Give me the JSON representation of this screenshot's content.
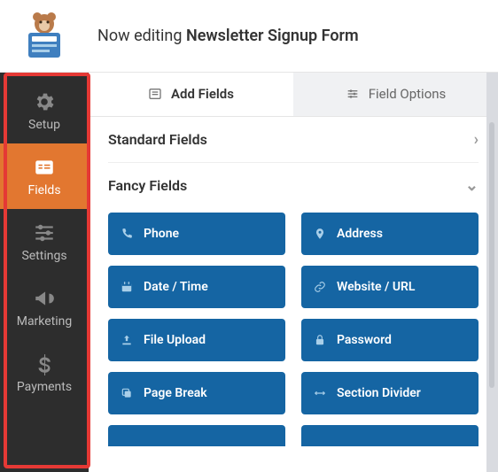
{
  "header": {
    "prefix": "Now editing ",
    "title_bold": "Newsletter Signup Form"
  },
  "sidebar": {
    "items": [
      {
        "label": "Setup"
      },
      {
        "label": "Fields"
      },
      {
        "label": "Settings"
      },
      {
        "label": "Marketing"
      },
      {
        "label": "Payments"
      }
    ]
  },
  "tabs": {
    "add": "Add Fields",
    "options": "Field Options"
  },
  "sections": {
    "standard": "Standard Fields",
    "fancy": "Fancy Fields"
  },
  "fields": {
    "phone": "Phone",
    "address": "Address",
    "datetime": "Date / Time",
    "website": "Website / URL",
    "upload": "File Upload",
    "password": "Password",
    "pagebreak": "Page Break",
    "section": "Section Divider"
  }
}
